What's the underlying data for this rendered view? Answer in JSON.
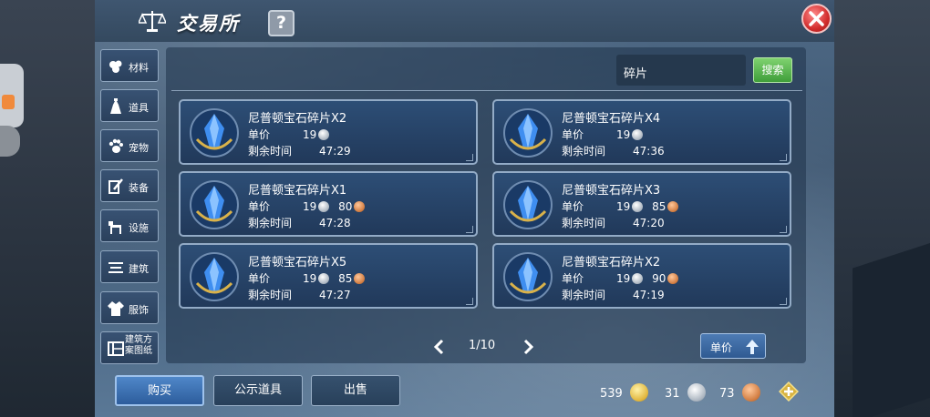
{
  "window": {
    "title": "交易所"
  },
  "tabs": [
    {
      "label": "材料",
      "icon": "material-icon"
    },
    {
      "label": "道具",
      "icon": "item-icon"
    },
    {
      "label": "宠物",
      "icon": "paw-icon"
    },
    {
      "label": "装备",
      "icon": "equipment-icon"
    },
    {
      "label": "设施",
      "icon": "facility-icon"
    },
    {
      "label": "建筑",
      "icon": "building-icon"
    },
    {
      "label": "服饰",
      "icon": "clothing-icon"
    },
    {
      "label": "建筑方案图纸",
      "icon": "blueprint-icon"
    }
  ],
  "search": {
    "value": "碎片",
    "button_label": "搜索"
  },
  "listings": [
    {
      "name": "尼普顿宝石碎片X2",
      "price_label": "单价",
      "silver": "19",
      "copper": "",
      "time_label": "剩余时间",
      "time": "47:29"
    },
    {
      "name": "尼普顿宝石碎片X4",
      "price_label": "单价",
      "silver": "19",
      "copper": "",
      "time_label": "剩余时间",
      "time": "47:36"
    },
    {
      "name": "尼普顿宝石碎片X1",
      "price_label": "单价",
      "silver": "19",
      "copper": "80",
      "time_label": "剩余时间",
      "time": "47:28"
    },
    {
      "name": "尼普顿宝石碎片X3",
      "price_label": "单价",
      "silver": "19",
      "copper": "85",
      "time_label": "剩余时间",
      "time": "47:20"
    },
    {
      "name": "尼普顿宝石碎片X5",
      "price_label": "单价",
      "silver": "19",
      "copper": "85",
      "time_label": "剩余时间",
      "time": "47:27"
    },
    {
      "name": "尼普顿宝石碎片X2",
      "price_label": "单价",
      "silver": "19",
      "copper": "90",
      "time_label": "剩余时间",
      "time": "47:19"
    }
  ],
  "pager": {
    "text": "1/10"
  },
  "sort": {
    "label": "单价"
  },
  "bottom": {
    "buy": "购买",
    "public": "公示道具",
    "sell": "出售"
  },
  "currency": {
    "gold": "539",
    "silver": "31",
    "copper": "73"
  },
  "colors": {
    "accent": "#3f9e3a",
    "close": "#d22d2d",
    "card_border": "#93abc6"
  }
}
